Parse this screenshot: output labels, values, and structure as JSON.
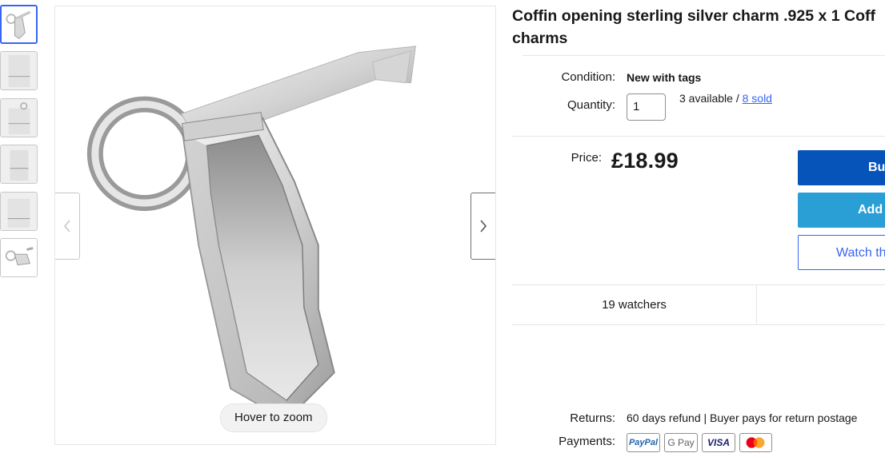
{
  "gallery": {
    "thumbnail_count": 6,
    "selected_index": 0,
    "zoom_hint": "Hover to zoom",
    "prev_icon": "chevron-left-icon",
    "next_icon": "chevron-right-icon"
  },
  "listing": {
    "title_line1": "Coffin opening sterling silver charm .925 x 1 Coff",
    "title_line2": "charms",
    "condition_label": "Condition:",
    "condition_value": "New with tags",
    "quantity_label": "Quantity:",
    "quantity_value": "1",
    "available_text": "3 available /",
    "sold_link": "8 sold",
    "price_label": "Price:",
    "price_value": "£18.99",
    "buy_button": "Bu",
    "add_button": "Add",
    "watch_button": "Watch th",
    "watchers_text": "19 watchers",
    "returns_label": "Returns:",
    "returns_value": "60 days refund | Buyer pays for return postage",
    "payments_label": "Payments:",
    "payment_methods": [
      "PayPal",
      "G Pay",
      "VISA",
      "Mastercard"
    ]
  },
  "colors": {
    "accent_blue": "#3665f3",
    "buy_button_bg": "#0654ba",
    "add_button_bg": "#2a9fd6",
    "text": "#191919"
  }
}
